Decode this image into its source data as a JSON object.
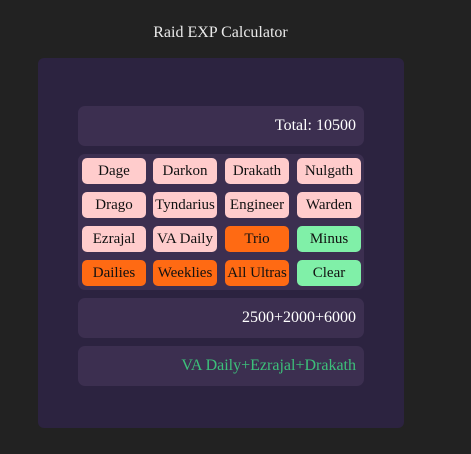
{
  "app": {
    "title": "Raid EXP Calculator"
  },
  "display": {
    "total": "Total: 10500",
    "values": "2500+2000+6000",
    "names": "VA Daily+Ezrajal+Drakath"
  },
  "keypad": {
    "keys": [
      [
        "Dage",
        "Darkon",
        "Drakath",
        "Nulgath"
      ],
      [
        "Drago",
        "Tyndarius",
        "Engineer",
        "Warden"
      ],
      [
        "Ezrajal",
        "VA Daily",
        "Trio",
        "Minus"
      ],
      [
        "Dailies",
        "Weeklies",
        "All Ultras",
        "Clear"
      ]
    ]
  },
  "colors": {
    "background": "#222222",
    "panel": "#2c2340",
    "display": "#3c2f50",
    "boss_key": "#ffcccc",
    "preset_key": "#ff6a13",
    "control_key": "#80f0a8",
    "names_text": "#3cc07a"
  }
}
